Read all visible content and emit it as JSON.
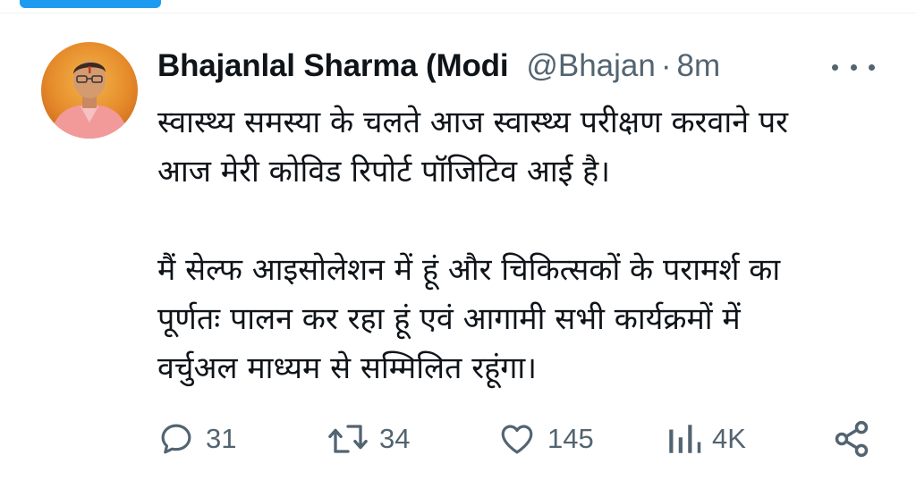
{
  "tweet": {
    "author": {
      "display_name": "Bhajanlal Sharma (Modi",
      "handle": "@Bhajan",
      "separator": "·",
      "time": "8m"
    },
    "text": {
      "paragraph1_line1": "स्वास्थ्य समस्या के चलते आज स्वास्थ्य परीक्षण करवाने पर",
      "paragraph1_line2": "आज मेरी कोविड रिपोर्ट पॉजिटिव आई है।",
      "paragraph2_line1": "मैं सेल्फ आइसोलेशन में हूं और चिकित्सकों के परामर्श का",
      "paragraph2_line2": "पूर्णतः पालन कर रहा हूं एवं आगामी सभी कार्यक्रमों में",
      "paragraph2_line3": "वर्चुअल माध्यम से सम्मिलित रहूंगा।"
    },
    "actions": {
      "replies": "31",
      "retweets": "34",
      "likes": "145",
      "views": "4K"
    }
  },
  "icons": {
    "reply": "reply-icon",
    "retweet": "retweet-icon",
    "like": "heart-icon",
    "views": "views-icon",
    "share": "share-icon",
    "more": "more-icon"
  },
  "colors": {
    "accent": "#1d9bf0",
    "text_primary": "#0f1419",
    "text_secondary": "#536471"
  }
}
